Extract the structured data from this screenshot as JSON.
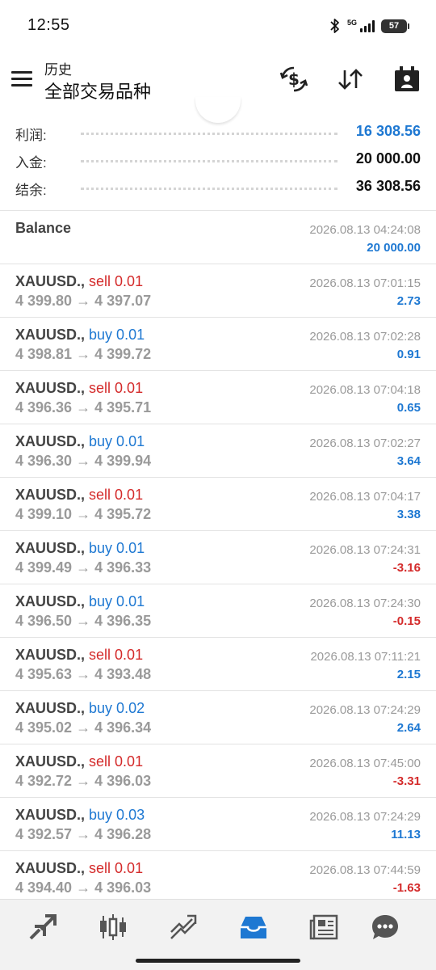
{
  "status_bar": {
    "time": "12:55",
    "network": "5G",
    "battery": "57"
  },
  "header": {
    "subtitle": "历史",
    "title": "全部交易品种"
  },
  "icons": {
    "menu": "menu-icon",
    "dollar_exchange": "dollar-exchange-icon",
    "sort": "sort-icon",
    "calendar": "calendar-icon"
  },
  "summary": [
    {
      "label": "利润:",
      "value": "16 308.56",
      "color": "#1e78d2"
    },
    {
      "label": "入金:",
      "value": "20 000.00",
      "color": "#111111"
    },
    {
      "label": "结余:",
      "value": "36 308.56",
      "color": "#111111"
    }
  ],
  "balance_row": {
    "label": "Balance",
    "time": "2026.08.13 04:24:08",
    "amount": "20 000.00"
  },
  "deals": [
    {
      "symbol": "XAUUSD.,",
      "side": "sell 0.01",
      "type": "sell",
      "open": "4 399.80",
      "close": "4 397.07",
      "time": "2026.08.13 07:01:15",
      "profit": "2.73",
      "sign": "pos"
    },
    {
      "symbol": "XAUUSD.,",
      "side": "buy 0.01",
      "type": "buy",
      "open": "4 398.81",
      "close": "4 399.72",
      "time": "2026.08.13 07:02:28",
      "profit": "0.91",
      "sign": "pos"
    },
    {
      "symbol": "XAUUSD.,",
      "side": "sell 0.01",
      "type": "sell",
      "open": "4 396.36",
      "close": "4 395.71",
      "time": "2026.08.13 07:04:18",
      "profit": "0.65",
      "sign": "pos"
    },
    {
      "symbol": "XAUUSD.,",
      "side": "buy 0.01",
      "type": "buy",
      "open": "4 396.30",
      "close": "4 399.94",
      "time": "2026.08.13 07:02:27",
      "profit": "3.64",
      "sign": "pos"
    },
    {
      "symbol": "XAUUSD.,",
      "side": "sell 0.01",
      "type": "sell",
      "open": "4 399.10",
      "close": "4 395.72",
      "time": "2026.08.13 07:04:17",
      "profit": "3.38",
      "sign": "pos"
    },
    {
      "symbol": "XAUUSD.,",
      "side": "buy 0.01",
      "type": "buy",
      "open": "4 399.49",
      "close": "4 396.33",
      "time": "2026.08.13 07:24:31",
      "profit": "-3.16",
      "sign": "neg"
    },
    {
      "symbol": "XAUUSD.,",
      "side": "buy 0.01",
      "type": "buy",
      "open": "4 396.50",
      "close": "4 396.35",
      "time": "2026.08.13 07:24:30",
      "profit": "-0.15",
      "sign": "neg"
    },
    {
      "symbol": "XAUUSD.,",
      "side": "sell 0.01",
      "type": "sell",
      "open": "4 395.63",
      "close": "4 393.48",
      "time": "2026.08.13 07:11:21",
      "profit": "2.15",
      "sign": "pos"
    },
    {
      "symbol": "XAUUSD.,",
      "side": "buy 0.02",
      "type": "buy",
      "open": "4 395.02",
      "close": "4 396.34",
      "time": "2026.08.13 07:24:29",
      "profit": "2.64",
      "sign": "pos"
    },
    {
      "symbol": "XAUUSD.,",
      "side": "sell 0.01",
      "type": "sell",
      "open": "4 392.72",
      "close": "4 396.03",
      "time": "2026.08.13 07:45:00",
      "profit": "-3.31",
      "sign": "neg"
    },
    {
      "symbol": "XAUUSD.,",
      "side": "buy 0.03",
      "type": "buy",
      "open": "4 392.57",
      "close": "4 396.28",
      "time": "2026.08.13 07:24:29",
      "profit": "11.13",
      "sign": "pos"
    },
    {
      "symbol": "XAUUSD.,",
      "side": "sell 0.01",
      "type": "sell",
      "open": "4 394.40",
      "close": "4 396.03",
      "time": "2026.08.13 07:44:59",
      "profit": "-1.63",
      "sign": "neg"
    }
  ],
  "arrow": "→",
  "bottom_nav": [
    {
      "icon": "quotes-icon",
      "active": false
    },
    {
      "icon": "chart-icon",
      "active": false
    },
    {
      "icon": "trade-icon",
      "active": false
    },
    {
      "icon": "history-icon",
      "active": true
    },
    {
      "icon": "news-icon",
      "active": false
    },
    {
      "icon": "chat-icon",
      "active": false
    }
  ],
  "colors": {
    "accent": "#1e78d2",
    "loss": "#d42b2b",
    "muted": "#9a9a9a"
  }
}
